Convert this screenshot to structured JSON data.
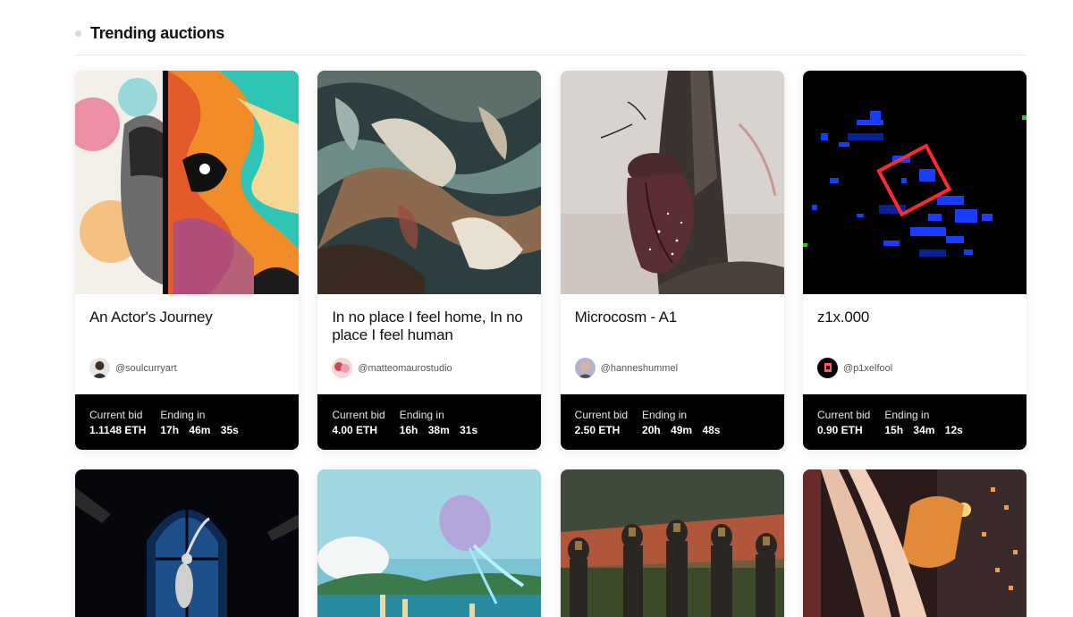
{
  "section": {
    "title": "Trending auctions"
  },
  "auctions": [
    {
      "title": "An Actor's Journey",
      "creator": "@soulcurryart",
      "bid_label": "Current bid",
      "bid": "1.1148 ETH",
      "ending_label": "Ending in",
      "hours": "17h",
      "minutes": "46m",
      "seconds": "35s"
    },
    {
      "title": "In no place I feel home, In no place I feel human",
      "creator": "@matteomaurostudio",
      "bid_label": "Current bid",
      "bid": "4.00 ETH",
      "ending_label": "Ending in",
      "hours": "16h",
      "minutes": "38m",
      "seconds": "31s"
    },
    {
      "title": "Microcosm - A1",
      "creator": "@hanneshummel",
      "bid_label": "Current bid",
      "bid": "2.50 ETH",
      "ending_label": "Ending in",
      "hours": "20h",
      "minutes": "49m",
      "seconds": "48s"
    },
    {
      "title": "z1x.000",
      "creator": "@p1xelfool",
      "bid_label": "Current bid",
      "bid": "0.90 ETH",
      "ending_label": "Ending in",
      "hours": "15h",
      "minutes": "34m",
      "seconds": "12s"
    }
  ],
  "colors": {
    "footer_bg": "#000000",
    "card_bg": "#ffffff",
    "title": "#111111",
    "handle": "#555555"
  }
}
